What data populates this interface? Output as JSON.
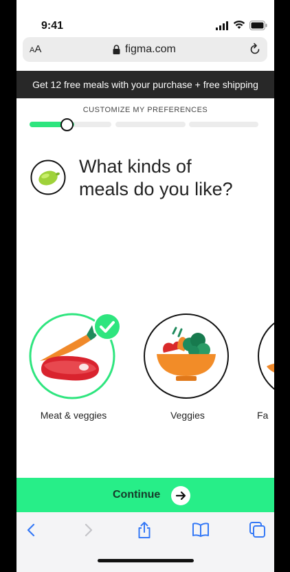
{
  "status_bar": {
    "time": "9:41"
  },
  "browser": {
    "text_size_large": "A",
    "text_size_small": "A",
    "url": "figma.com"
  },
  "promo_banner": "Get 12 free meals with your purchase + free shipping",
  "progress": {
    "label": "CUSTOMIZE MY PREFERENCES",
    "step": 1,
    "total_steps": 3,
    "current_step_fill": 0.55
  },
  "question": {
    "line1": "What kinds of",
    "line2": "meals do you like?"
  },
  "meal_options": [
    {
      "label": "Meat & veggies",
      "selected": true
    },
    {
      "label": "Veggies",
      "selected": false
    },
    {
      "label": "Fa",
      "selected": false
    }
  ],
  "continue_button": {
    "label": "Continue",
    "icon": "arrow-right-icon"
  },
  "colors": {
    "accent": "#27ee88",
    "banner": "#282828",
    "check": "#2ee57e"
  },
  "toolbar_icons": [
    "back-icon",
    "forward-icon",
    "share-icon",
    "bookmarks-icon",
    "tabs-icon"
  ]
}
